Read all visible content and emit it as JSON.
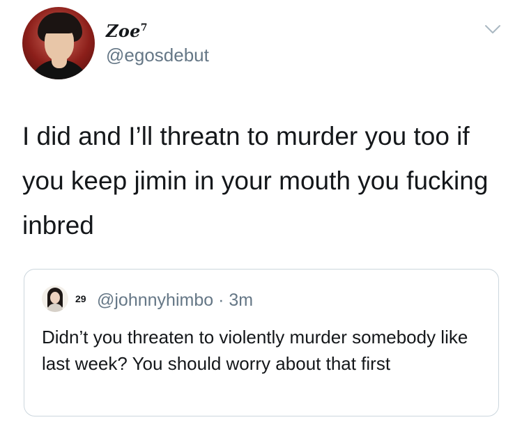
{
  "tweet": {
    "author": {
      "display_name": "Zoe",
      "name_superscript": "7",
      "handle": "@egosdebut"
    },
    "menu_icon": "chevron-down-icon",
    "text": "I did and I’ll threatn to murder you too if you keep jimin in your mouth you fucking inbred"
  },
  "quoted_tweet": {
    "author_name": "29",
    "meta": "@johnnyhimbo · 3m",
    "text": "Didn’t you threaten to violently murder somebody like last week? You should worry about that first"
  }
}
